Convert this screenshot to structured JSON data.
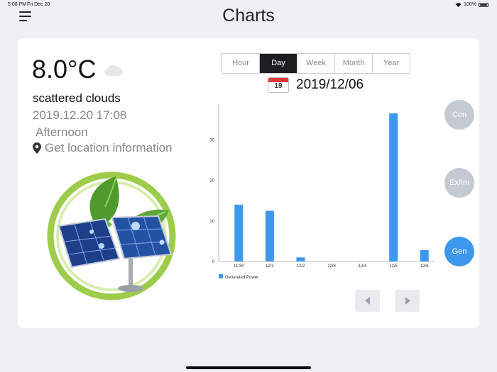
{
  "status_bar": {
    "time": "5:08 PM",
    "date": "Fri Dec 20",
    "battery": "100%"
  },
  "page_title": "Charts",
  "weather": {
    "temperature": "8.0°C",
    "description": "scattered clouds",
    "datetime": "2019.12.20 17:08",
    "period": "Afternoon",
    "location": "Get location information"
  },
  "tabs": [
    {
      "label": "Hour",
      "active": false
    },
    {
      "label": "Day",
      "active": true
    },
    {
      "label": "Week",
      "active": false
    },
    {
      "label": "Month",
      "active": false
    },
    {
      "label": "Year",
      "active": false
    }
  ],
  "date_picker": {
    "calendar_day": "19",
    "date": "2019/12/06"
  },
  "side_buttons": {
    "con": "Con",
    "exim": "Ex/Im",
    "gen": "Gen",
    "active": "Gen"
  },
  "colors": {
    "bar": "#3d97ec",
    "active_button": "#3d97ec",
    "inactive_button": "#c4c9d2",
    "active_tab": "#1e1e22"
  },
  "icons": {
    "menu": "hamburger-icon",
    "cloud": "cloud-icon",
    "location": "location-pin-icon",
    "calendar": "calendar-icon",
    "prev": "chevron-left-icon",
    "next": "chevron-right-icon"
  },
  "chart_data": {
    "type": "bar",
    "categories": [
      "11/30",
      "12/1",
      "12/2",
      "12/3",
      "12/4",
      "12/5",
      "12/6"
    ],
    "series": [
      {
        "name": "Generated Power",
        "values": [
          14,
          12.5,
          1,
          0,
          0,
          36.5,
          2.8
        ]
      }
    ],
    "yticks": [
      0,
      10,
      20,
      30
    ],
    "ylim": [
      0,
      40
    ],
    "legend": "bottom-left",
    "grid": false
  }
}
